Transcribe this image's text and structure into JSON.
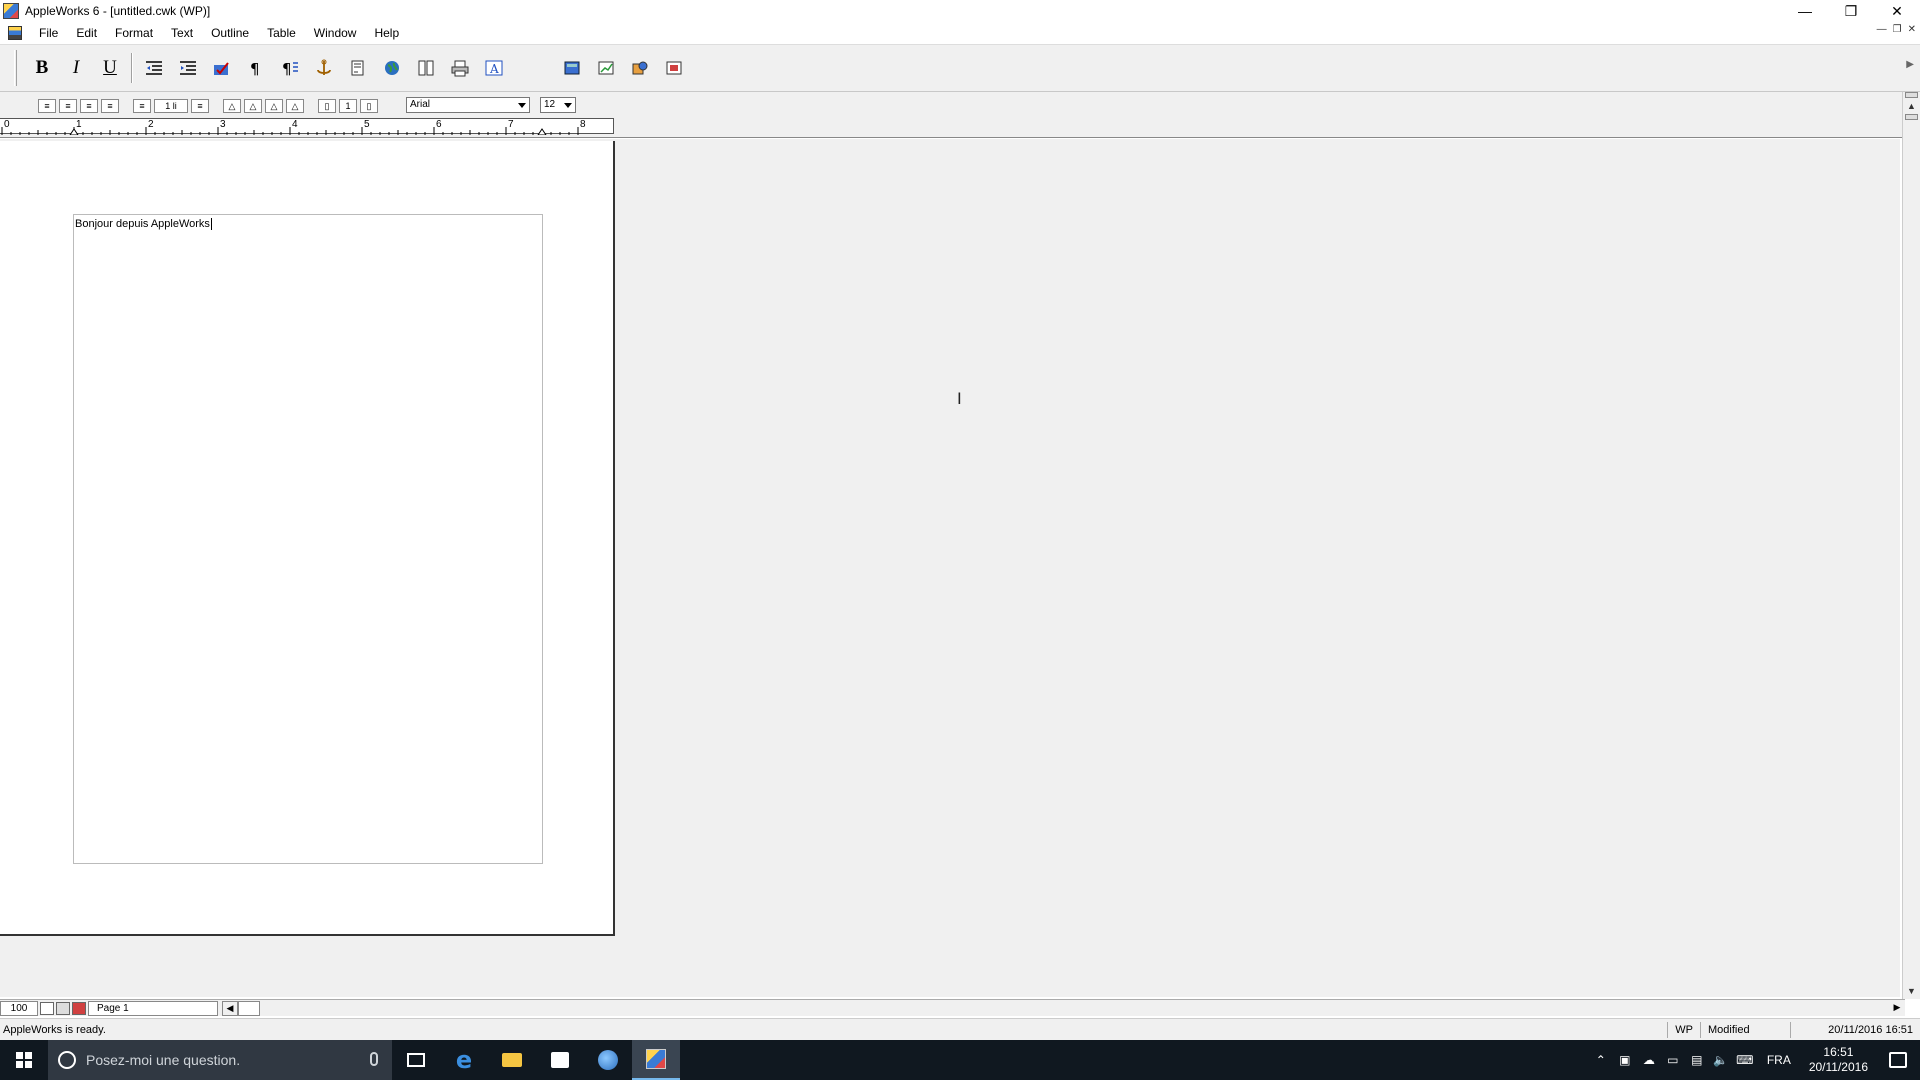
{
  "window": {
    "title": "AppleWorks 6 - [untitled.cwk (WP)]",
    "minimize": "—",
    "restore": "❐",
    "close": "✕"
  },
  "menu": {
    "items": [
      "File",
      "Edit",
      "Format",
      "Text",
      "Outline",
      "Table",
      "Window",
      "Help"
    ]
  },
  "toolbar": {
    "bold": "B",
    "italic": "I",
    "underline": "U"
  },
  "ruler": {
    "line_spacing": "1 li",
    "font": "Arial",
    "size": "12",
    "numbers": [
      "0",
      "1",
      "2",
      "3",
      "4",
      "5",
      "6",
      "7",
      "8"
    ]
  },
  "document": {
    "text": "Bonjour depuis AppleWorks"
  },
  "pagebar": {
    "zoom": "100",
    "page": "Page 1"
  },
  "status": {
    "message": "AppleWorks is ready.",
    "mode": "WP",
    "state": "Modified",
    "datetime": "20/11/2016 16:51"
  },
  "taskbar": {
    "search_placeholder": "Posez-moi une question.",
    "language": "FRA",
    "time": "16:51",
    "date": "20/11/2016"
  }
}
